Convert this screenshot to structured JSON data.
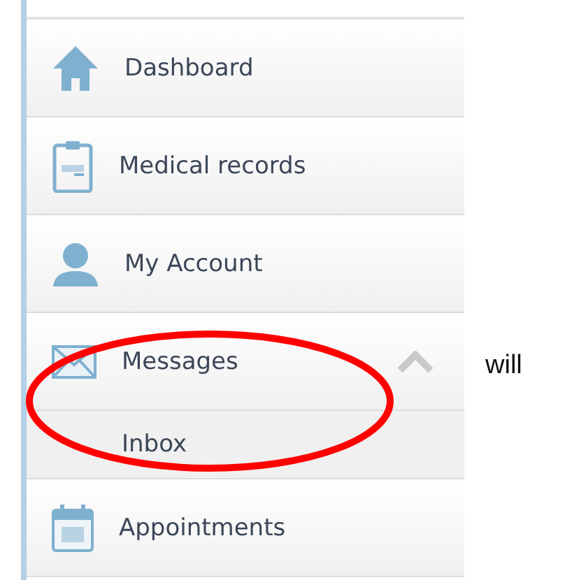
{
  "menu": {
    "items": [
      {
        "label": "Dashboard"
      },
      {
        "label": "Medical records"
      },
      {
        "label": "My Account"
      },
      {
        "label": "Messages",
        "expanded": true,
        "children": [
          {
            "label": "Inbox"
          }
        ]
      },
      {
        "label": "Appointments"
      }
    ]
  },
  "note": "will"
}
